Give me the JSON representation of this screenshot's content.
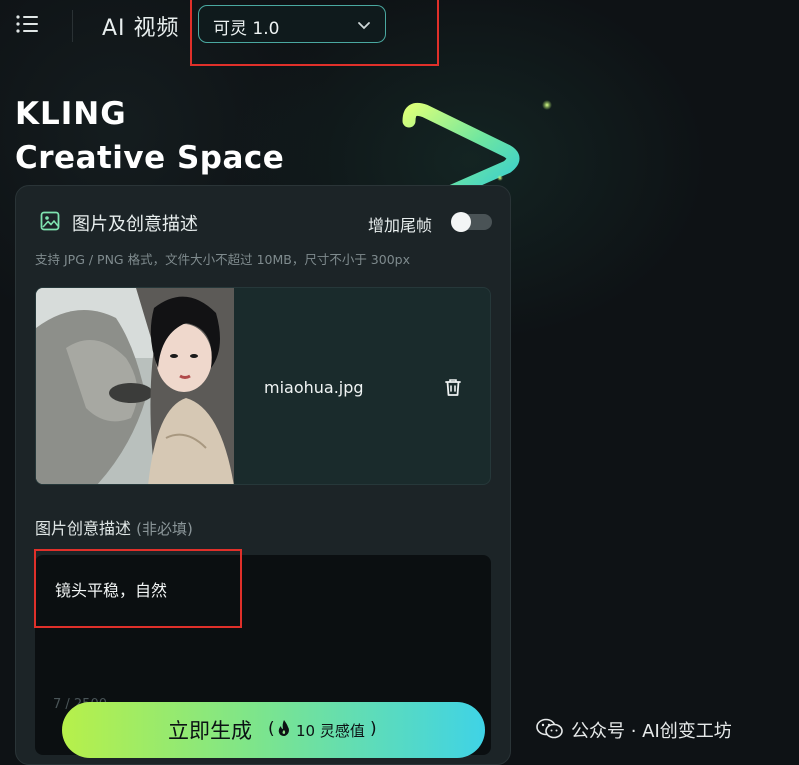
{
  "header": {
    "menu_icon": "hamburger-menu-icon",
    "app_title": "AI 视频",
    "model_select": {
      "selected": "可灵 1.0",
      "icon": "chevron-down-icon"
    }
  },
  "brand": {
    "line1": "KLING",
    "line2": "Creative Space"
  },
  "panel": {
    "section_title": "图片及创意描述",
    "section_icon": "image-icon",
    "tail_frame_label": "增加尾帧",
    "tail_frame_enabled": false,
    "upload_hint": "支持 JPG / PNG 格式，文件大小不超过 10MB，尺寸不小于 300px",
    "upload": {
      "file_name": "miaohua.jpg",
      "delete_icon": "trash-icon"
    },
    "prompt": {
      "title": "图片创意描述",
      "optional": "(非必填)",
      "value": "镜头平稳，自然",
      "counter": "7 / 2500"
    }
  },
  "generate": {
    "label": "立即生成",
    "paren_open": "(",
    "cost_icon": "fire-icon",
    "cost": "10 灵感值",
    "paren_close": ")"
  },
  "watermark": {
    "icon": "wechat-icon",
    "text": "公众号 · AI创变工坊"
  },
  "colors": {
    "accent_border": "#4aa8a0",
    "highlight_red": "#e0302a",
    "button_start": "#b7f04a",
    "button_end": "#3fd3e6"
  }
}
